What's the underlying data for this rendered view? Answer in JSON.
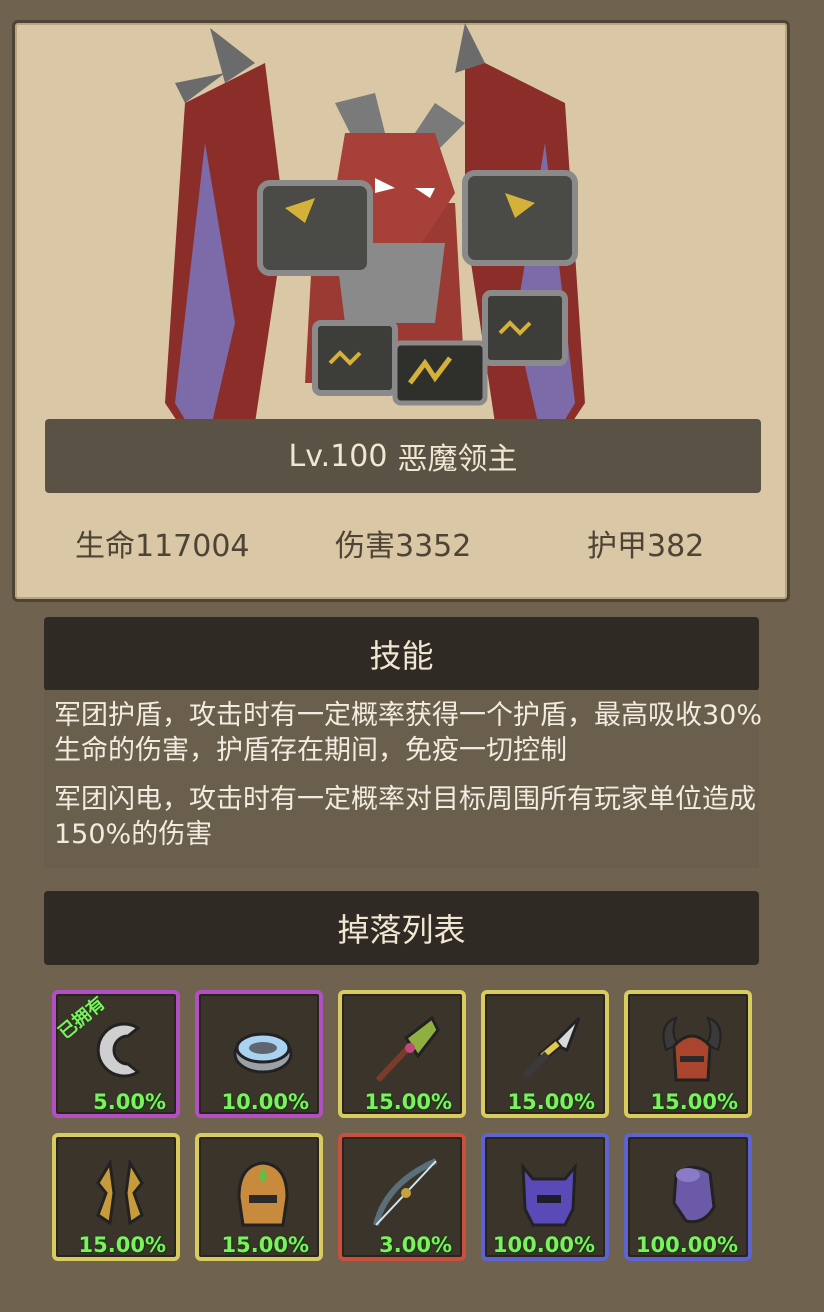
{
  "monster": {
    "level": "Lv.100",
    "name": "恶魔领主",
    "stats": [
      {
        "label": "生命",
        "value": "117004"
      },
      {
        "label": "伤害",
        "value": "3352"
      },
      {
        "label": "护甲",
        "value": "382"
      }
    ],
    "art_icon": "demon-lord-icon"
  },
  "skills": {
    "title": "技能",
    "items": [
      "军团护盾，攻击时有一定概率获得一个护盾，最高吸收30%生命的伤害，护盾存在期间，免疫一切控制",
      "军团闪电，攻击时有一定概率对目标周围所有玩家单位造成150%的伤害"
    ]
  },
  "drops": {
    "title": "掉落列表",
    "items": [
      {
        "icon": "claw-ring-icon",
        "rarity": "purple",
        "rate": "5.00%",
        "owned": "已拥有"
      },
      {
        "icon": "ring-icon",
        "rarity": "purple",
        "rate": "10.00%"
      },
      {
        "icon": "cleaver-icon",
        "rarity": "gold",
        "rate": "15.00%"
      },
      {
        "icon": "dagger-icon",
        "rarity": "gold",
        "rate": "15.00%"
      },
      {
        "icon": "horned-helmet-icon",
        "rarity": "gold",
        "rate": "15.00%"
      },
      {
        "icon": "gauntlets-icon",
        "rarity": "gold",
        "rate": "15.00%"
      },
      {
        "icon": "gold-helmet-icon",
        "rarity": "gold",
        "rate": "15.00%"
      },
      {
        "icon": "bow-icon",
        "rarity": "red",
        "rate": "3.00%"
      },
      {
        "icon": "purple-helmet-icon",
        "rarity": "blue",
        "rate": "100.00%"
      },
      {
        "icon": "purple-armor-icon",
        "rarity": "blue",
        "rate": "100.00%"
      }
    ]
  },
  "colors": {
    "purple": "#b24fc2",
    "gold": "#d8cc5e",
    "red": "#c8503d",
    "blue": "#5d63cf",
    "rate_text": "#7bf25d"
  }
}
